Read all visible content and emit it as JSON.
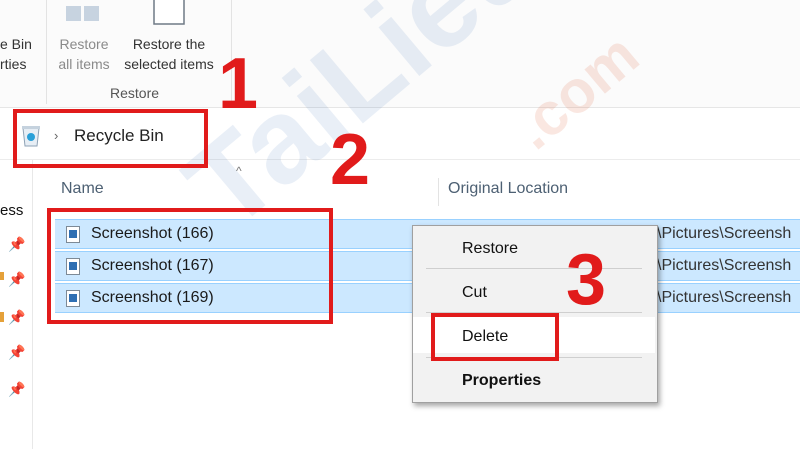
{
  "ribbon": {
    "partial_button": {
      "line1": "e Bin",
      "line2": "rties"
    },
    "restore_all": {
      "line1": "Restore",
      "line2": "all items"
    },
    "restore_selected": {
      "line1": "Restore the",
      "line2": "selected items"
    },
    "group_label": "Restore"
  },
  "address_bar": {
    "location": "Recycle Bin"
  },
  "nav": {
    "partial_label": "ess"
  },
  "columns": {
    "name": "Name",
    "original_location": "Original Location"
  },
  "files": [
    {
      "name": "Screenshot (166)",
      "location": "\\Pictures\\Screensh"
    },
    {
      "name": "Screenshot (167)",
      "location": "\\Pictures\\Screensh"
    },
    {
      "name": "Screenshot (169)",
      "location": "\\Pictures\\Screensh"
    }
  ],
  "context_menu": {
    "restore": "Restore",
    "cut": "Cut",
    "delete": "Delete",
    "properties": "Properties"
  },
  "annotations": {
    "step1": "1",
    "step2": "2",
    "step3": "3"
  },
  "watermark": {
    "brand": "TaiLieu",
    "suffix": ".com"
  },
  "colors": {
    "annotation_red": "#e11b1b",
    "selection_blue": "#cce8ff",
    "watermark_blue": "#2a60b2"
  }
}
